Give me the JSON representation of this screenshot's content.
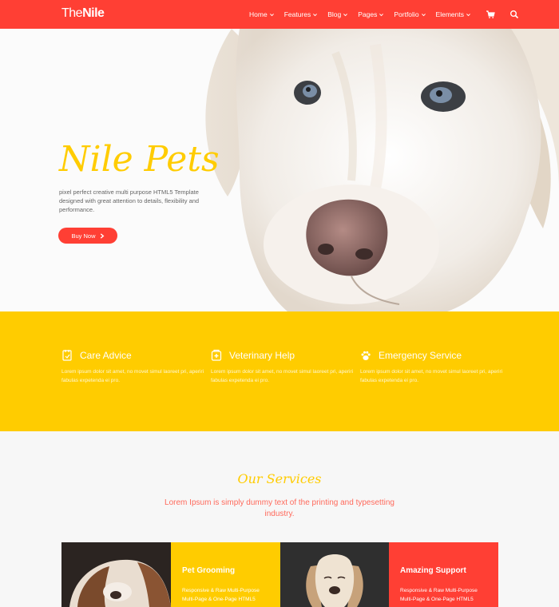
{
  "brand": {
    "logo_thin": "The",
    "logo_bold": "Nile"
  },
  "nav": {
    "items": [
      "Home",
      "Features",
      "Blog",
      "Pages",
      "Portfolio",
      "Elements"
    ],
    "icons": [
      "cart-icon",
      "search-icon"
    ]
  },
  "hero": {
    "title": "Nile Pets",
    "description": "pixel perfect creative multi purpose HTML5 Template designed with great attention to details, flexibility and performance.",
    "button_label": "Buy Now"
  },
  "features": [
    {
      "title": "Care Advice",
      "icon": "care-advice-icon",
      "text": "Lorem ipsum dolor sit amet, no movet simul laoreet pri, aperiri fabulas expetenda ei pro."
    },
    {
      "title": "Veterinary Help",
      "icon": "veterinary-help-icon",
      "text": "Lorem ipsum dolor sit amet, no movet simul laoreet pri, aperiri fabulas expetenda ei pro."
    },
    {
      "title": "Emergency Service",
      "icon": "paw-icon",
      "text": "Lorem ipsum dolor sit amet, no movet simul laoreet pri, aperiri fabulas expetenda ei pro."
    }
  ],
  "services": {
    "title": "Our Services",
    "subtitle": "Lorem Ipsum is simply dummy text of the printing and typesetting industry.",
    "cards": [
      {
        "title": "Pet Grooming",
        "text": "Responsive & Raw Multi-Purpose Multi-Page & One-Page HTML5"
      },
      {
        "title": "Amazing Support",
        "text": "Responsive & Raw Multi-Purpose Multi-Page & One-Page HTML5"
      }
    ]
  },
  "colors": {
    "primary": "#ff3f34",
    "accent": "#ffcc00",
    "background": "#f7f7f7"
  }
}
